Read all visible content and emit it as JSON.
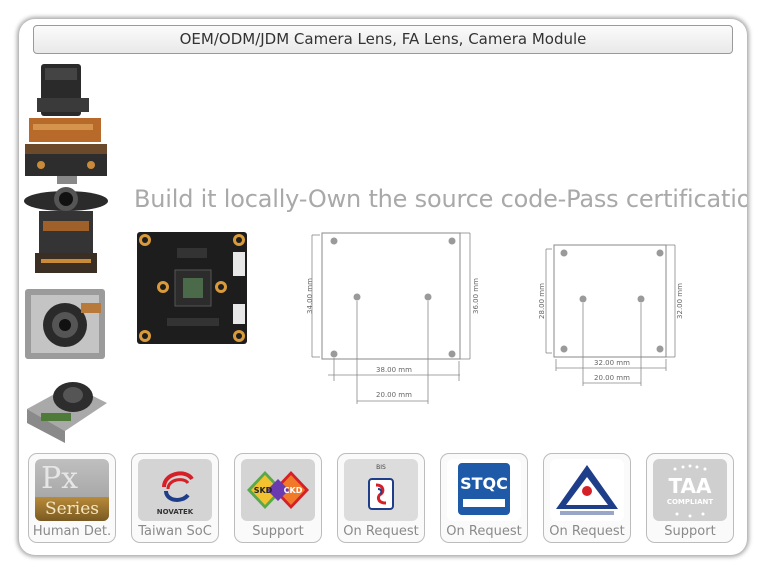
{
  "header": {
    "title": "OEM/ODM/JDM Camera Lens, FA Lens, Camera Module"
  },
  "tagline": "Build it locally-Own the source code-Pass certification",
  "diagrams": [
    {
      "height_label": "34.00 mm",
      "outer_height_label": "36.00 mm",
      "width_label": "38.00 mm",
      "inner_width_label": "20.00 mm"
    },
    {
      "height_label": "28.00 mm",
      "outer_height_label": "32.00 mm",
      "width_label": "32.00 mm",
      "inner_width_label": "20.00 mm"
    }
  ],
  "badges": [
    {
      "label": "Human Det.",
      "icon": "px-series-icon",
      "logo_text": [
        "Px",
        "Series"
      ]
    },
    {
      "label": "Taiwan SoC",
      "icon": "novatek-icon",
      "logo_text": [
        "NOVATEK"
      ]
    },
    {
      "label": "Support",
      "icon": "skd-ckd-icon",
      "logo_text": [
        "SKD",
        "CKD"
      ]
    },
    {
      "label": "On Request",
      "icon": "bis-icon",
      "logo_text": [
        "BIS"
      ]
    },
    {
      "label": "On Request",
      "icon": "stqc-icon",
      "logo_text": [
        "STQC"
      ]
    },
    {
      "label": "On Request",
      "icon": "bureau-indian-standards-icon",
      "logo_text": []
    },
    {
      "label": "Support",
      "icon": "taa-compliant-icon",
      "logo_text": [
        "TAA",
        "COMPLIANT"
      ]
    }
  ],
  "colors": {
    "badge_bg": "#d4d4d4",
    "tagline": "#a9a9a9",
    "stqc_blue": "#1f5aa8",
    "novatek_red": "#d62027"
  }
}
